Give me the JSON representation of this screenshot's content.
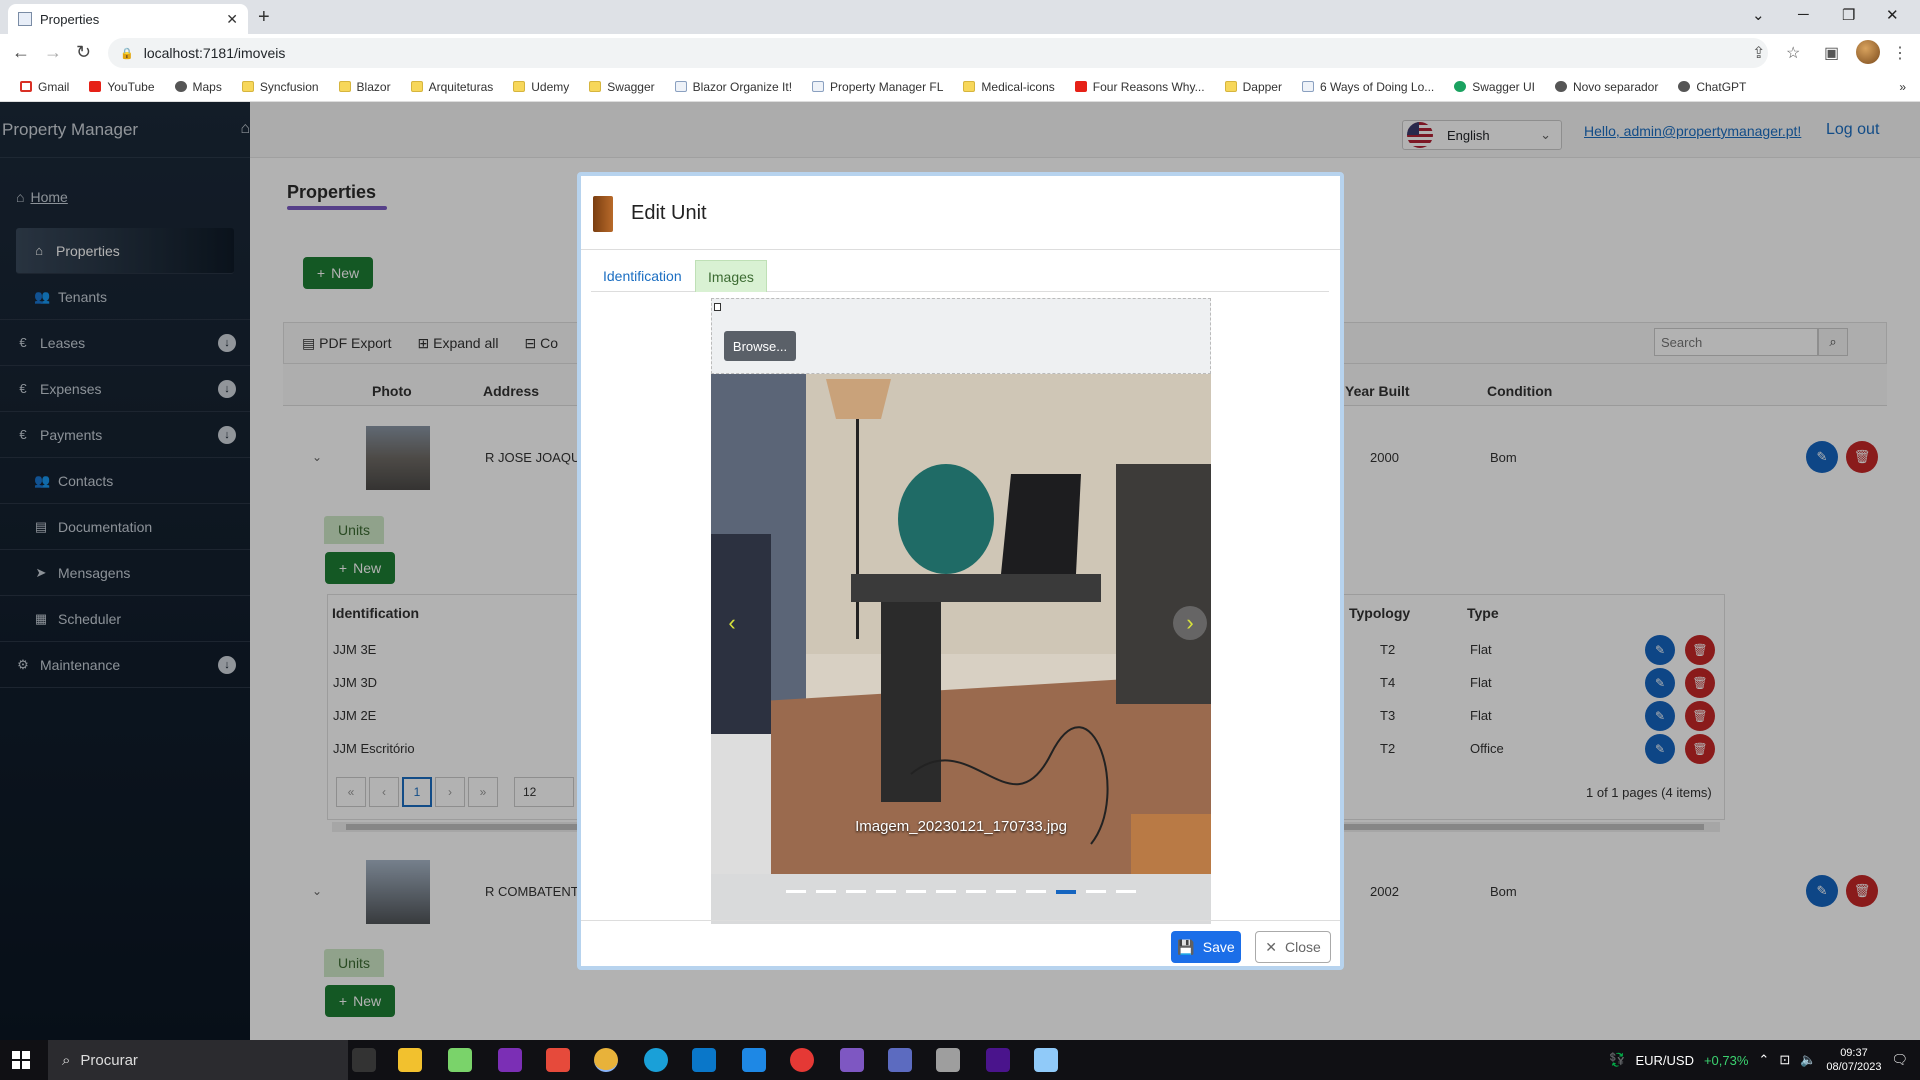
{
  "browser": {
    "tab_title": "Properties",
    "url": "localhost:7181/imoveis",
    "bookmarks": [
      {
        "label": "Gmail",
        "icon": "gm"
      },
      {
        "label": "YouTube",
        "icon": "yt"
      },
      {
        "label": "Maps",
        "icon": "gen"
      },
      {
        "label": "Syncfusion",
        "icon": "folder"
      },
      {
        "label": "Blazor",
        "icon": "folder"
      },
      {
        "label": "Arquiteturas",
        "icon": "folder"
      },
      {
        "label": "Udemy",
        "icon": "folder"
      },
      {
        "label": "Swagger",
        "icon": "folder"
      },
      {
        "label": "Blazor Organize It!",
        "icon": "page"
      },
      {
        "label": "Property Manager FL",
        "icon": "page"
      },
      {
        "label": "Medical-icons",
        "icon": "folder"
      },
      {
        "label": "Four Reasons Why...",
        "icon": "yt"
      },
      {
        "label": "Dapper",
        "icon": "folder"
      },
      {
        "label": "6 Ways of Doing Lo...",
        "icon": "page"
      },
      {
        "label": "Swagger UI",
        "icon": "gl"
      },
      {
        "label": "Novo separador",
        "icon": "gen"
      },
      {
        "label": "ChatGPT",
        "icon": "gen"
      }
    ]
  },
  "sidebar": {
    "brand": "Property Manager",
    "home_link": "Home",
    "items": [
      {
        "label": "Properties",
        "icon": "home-icon",
        "active": true
      },
      {
        "label": "Tenants",
        "icon": "users-icon"
      },
      {
        "label": "Leases",
        "icon": "euro-icon",
        "expand": true
      },
      {
        "label": "Expenses",
        "icon": "euro-icon",
        "expand": true
      },
      {
        "label": "Payments",
        "icon": "euro-icon",
        "expand": true
      },
      {
        "label": "Contacts",
        "icon": "users-icon"
      },
      {
        "label": "Documentation",
        "icon": "document-icon"
      },
      {
        "label": "Mensagens",
        "icon": "send-icon"
      },
      {
        "label": "Scheduler",
        "icon": "calendar-icon"
      },
      {
        "label": "Maintenance",
        "icon": "gear-icon",
        "expand": true
      }
    ]
  },
  "topbar": {
    "language": "English",
    "hello": "Hello, admin@propertymanager.pt!",
    "logout": "Log out"
  },
  "page": {
    "title": "Properties",
    "new_label": "New",
    "toolbar": {
      "pdf": "PDF Export",
      "expand": "Expand all",
      "co": "Co"
    },
    "search_placeholder": "Search",
    "columns": {
      "photo": "Photo",
      "address": "Address",
      "year": "Year Built",
      "condition": "Condition"
    },
    "rows": [
      {
        "address": "R JOSE JOAQU",
        "year": "2000",
        "condition": "Bom"
      },
      {
        "address": "R COMBATENT",
        "year": "2002",
        "condition": "Bom"
      }
    ],
    "units_tab": "Units",
    "units_new": "New",
    "unit_columns": {
      "identification": "Identification",
      "typology": "Typology",
      "type": "Type"
    },
    "units": [
      {
        "id": "JJM 3E",
        "typology": "T2",
        "type": "Flat"
      },
      {
        "id": "JJM 3D",
        "typology": "T4",
        "type": "Flat"
      },
      {
        "id": "JJM 2E",
        "typology": "T3",
        "type": "Flat"
      },
      {
        "id": "JJM Escritório",
        "typology": "T2",
        "type": "Office"
      }
    ],
    "pager": {
      "current": "1",
      "page_size": "12",
      "summary": "1 of 1 pages (4 items)"
    }
  },
  "modal": {
    "title": "Edit Unit",
    "tabs": [
      "Identification",
      "Images"
    ],
    "selected_tab": "Images",
    "browse_label": "Browse...",
    "image_caption": "Imagem_20230121_170733.jpg",
    "slide_count": 12,
    "active_slide": 10,
    "save_label": "Save",
    "close_label": "Close"
  },
  "taskbar": {
    "search_placeholder": "Procurar",
    "ticker": "EUR/USD",
    "ticker_change": "+0,73%",
    "time": "09:37",
    "date": "08/07/2023"
  },
  "colors": {
    "accent": "#1b6ec2",
    "green": "#1e7e34",
    "sidebar": "#0b1623"
  }
}
